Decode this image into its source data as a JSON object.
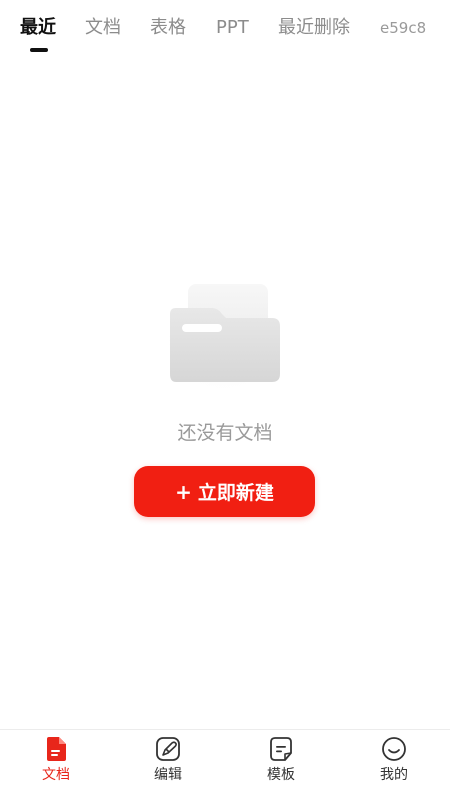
{
  "tabs": {
    "items": [
      {
        "label": "最近",
        "active": true
      },
      {
        "label": "文档",
        "active": false
      },
      {
        "label": "表格",
        "active": false
      },
      {
        "label": "PPT",
        "active": false
      },
      {
        "label": "最近删除",
        "active": false
      }
    ],
    "extra_label": "e59c8"
  },
  "empty_state": {
    "icon": "empty-folder-icon",
    "message": "还没有文档",
    "button_label": "立即新建",
    "button_prefix": "+"
  },
  "bottom_nav": {
    "items": [
      {
        "label": "文档",
        "icon": "document-icon",
        "active": true
      },
      {
        "label": "编辑",
        "icon": "edit-pen-icon",
        "active": false
      },
      {
        "label": "模板",
        "icon": "template-icon",
        "active": false
      },
      {
        "label": "我的",
        "icon": "profile-smile-icon",
        "active": false
      }
    ]
  },
  "colors": {
    "accent": "#f11f12",
    "active_tab": "#111111",
    "inactive_tab": "#8c8c8c",
    "empty_text": "#9a9a9a"
  }
}
